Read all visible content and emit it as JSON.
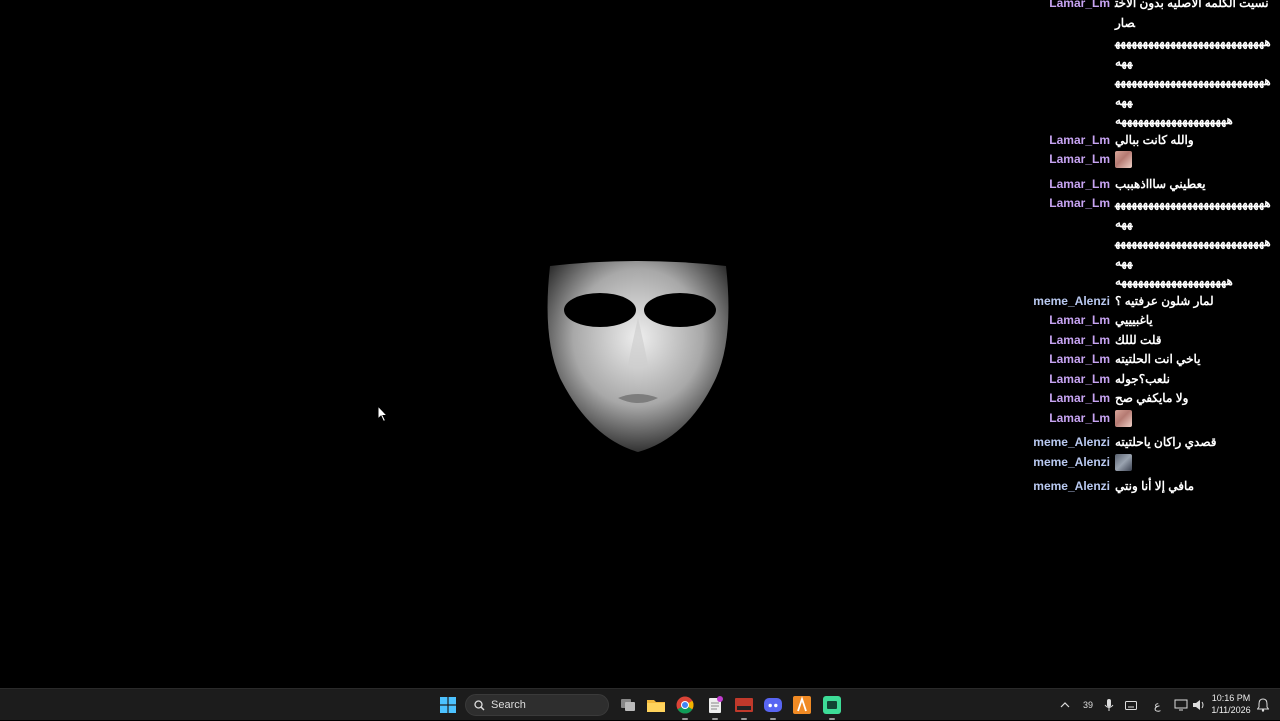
{
  "chat": {
    "messages": [
      {
        "user": "Lamar_Lm",
        "text": "نسيت الكلمه الاصليه بدون الاختصار",
        "emote": false
      },
      {
        "user": "",
        "text": "ههههههههههههههههههههههههههههههه",
        "emote": false
      },
      {
        "user": "",
        "text": "ههههههههههههههههههههههههههههههه",
        "emote": false
      },
      {
        "user": "",
        "text": "ههههههههههههههههههههه",
        "emote": false
      },
      {
        "user": "Lamar_Lm",
        "text": "والله كانت ببالي",
        "emote": false
      },
      {
        "user": "Lamar_Lm",
        "text": "",
        "emote": true
      },
      {
        "user": "Lamar_Lm",
        "text": "يعطيني ساااذهببب",
        "emote": false
      },
      {
        "user": "Lamar_Lm",
        "text": "ههههههههههههههههههههههههههههههه",
        "emote": false
      },
      {
        "user": "",
        "text": "ههههههههههههههههههههههههههههههه",
        "emote": false
      },
      {
        "user": "",
        "text": "ههههههههههههههههههههه",
        "emote": false
      },
      {
        "user": "meme_Alenzi",
        "text": "لمار شلون عرفتيه ؟",
        "emote": false
      },
      {
        "user": "Lamar_Lm",
        "text": "ياغبيييي",
        "emote": false
      },
      {
        "user": "Lamar_Lm",
        "text": "قلت لللك",
        "emote": false
      },
      {
        "user": "Lamar_Lm",
        "text": "ياخي انت الحلتيته",
        "emote": false
      },
      {
        "user": "Lamar_Lm",
        "text": "نلعب؟جوله",
        "emote": false
      },
      {
        "user": "Lamar_Lm",
        "text": "ولا مايكفي صح",
        "emote": false
      },
      {
        "user": "Lamar_Lm",
        "text": "",
        "emote": true
      },
      {
        "user": "meme_Alenzi",
        "text": "قصدي راكان ياحلتيته",
        "emote": false
      },
      {
        "user": "meme_Alenzi",
        "text": "",
        "emote": true
      },
      {
        "user": "meme_Alenzi",
        "text": "مافي إلا أنا ونتي",
        "emote": false
      }
    ]
  },
  "taskbar": {
    "search_label": "Search",
    "apps": [
      {
        "icon": "windows-start-icon"
      },
      {
        "icon": "search-icon"
      },
      {
        "icon": "task-view-icon"
      },
      {
        "icon": "file-explorer-icon"
      },
      {
        "icon": "chrome-icon"
      },
      {
        "icon": "notepad-icon"
      },
      {
        "icon": "voicemeeter-icon"
      },
      {
        "icon": "discord-icon"
      },
      {
        "icon": "ableton-icon"
      },
      {
        "icon": "obs-app-icon"
      }
    ],
    "tray": {
      "badge_count": "39",
      "lang": "ع",
      "time": "10:16 PM",
      "date": "1/11/2026"
    }
  },
  "colors": {
    "lamar_name": "#c7a4f2",
    "meme_name": "#b9c9f0",
    "taskbar_bg": "#1c1c1c",
    "desktop_bg": "#000000"
  }
}
